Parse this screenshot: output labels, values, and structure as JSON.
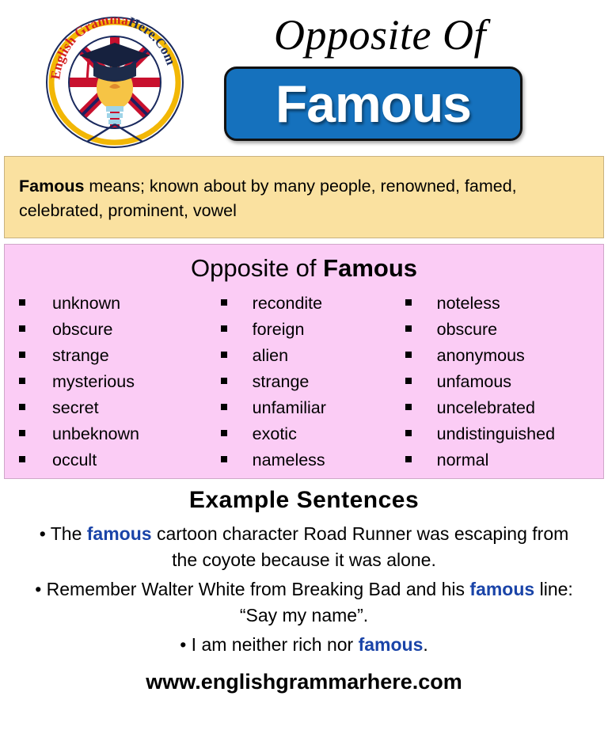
{
  "header": {
    "title": "Opposite Of",
    "word": "Famous",
    "badge_color": "#1571bd",
    "logo": {
      "name": "english-grammar-here-logo",
      "text_top": "English Grammar",
      "text_bottom": "Here.Com",
      "ring_color": "#f2b705",
      "text_color_left": "#d32020",
      "text_color_right": "#1a2a5e"
    }
  },
  "definition": {
    "word": "Famous",
    "text": " means; known about by many people, renowned, famed, celebrated, prominent, vowel",
    "background": "#fae1a0"
  },
  "opposites": {
    "heading_prefix": "Opposite of ",
    "heading_word": "Famous",
    "background": "#fbccf5",
    "columns": [
      [
        "unknown",
        "obscure",
        "strange",
        "mysterious",
        "secret",
        "unbeknown",
        "occult"
      ],
      [
        "recondite",
        "foreign",
        "alien",
        "strange",
        "unfamiliar",
        "exotic",
        "nameless"
      ],
      [
        "noteless",
        "obscure",
        "anonymous",
        "unfamous",
        "uncelebrated",
        "undistinguished",
        "normal"
      ]
    ]
  },
  "examples": {
    "heading": "Example Sentences",
    "keyword_color": "#1a44a8",
    "sentences": [
      {
        "parts": [
          {
            "t": "The ",
            "kw": false
          },
          {
            "t": "famous",
            "kw": true
          },
          {
            "t": " cartoon character Road Runner was escaping from the coyote because it was alone.",
            "kw": false
          }
        ]
      },
      {
        "parts": [
          {
            "t": "Remember Walter White from Breaking Bad and his ",
            "kw": false
          },
          {
            "t": "famous",
            "kw": true
          },
          {
            "t": " line: “Say my name”.",
            "kw": false
          }
        ]
      },
      {
        "parts": [
          {
            "t": "I am neither rich nor ",
            "kw": false
          },
          {
            "t": "famous",
            "kw": true
          },
          {
            "t": ".",
            "kw": false
          }
        ]
      }
    ]
  },
  "footer": {
    "url": "www.englishgrammarhere.com"
  }
}
